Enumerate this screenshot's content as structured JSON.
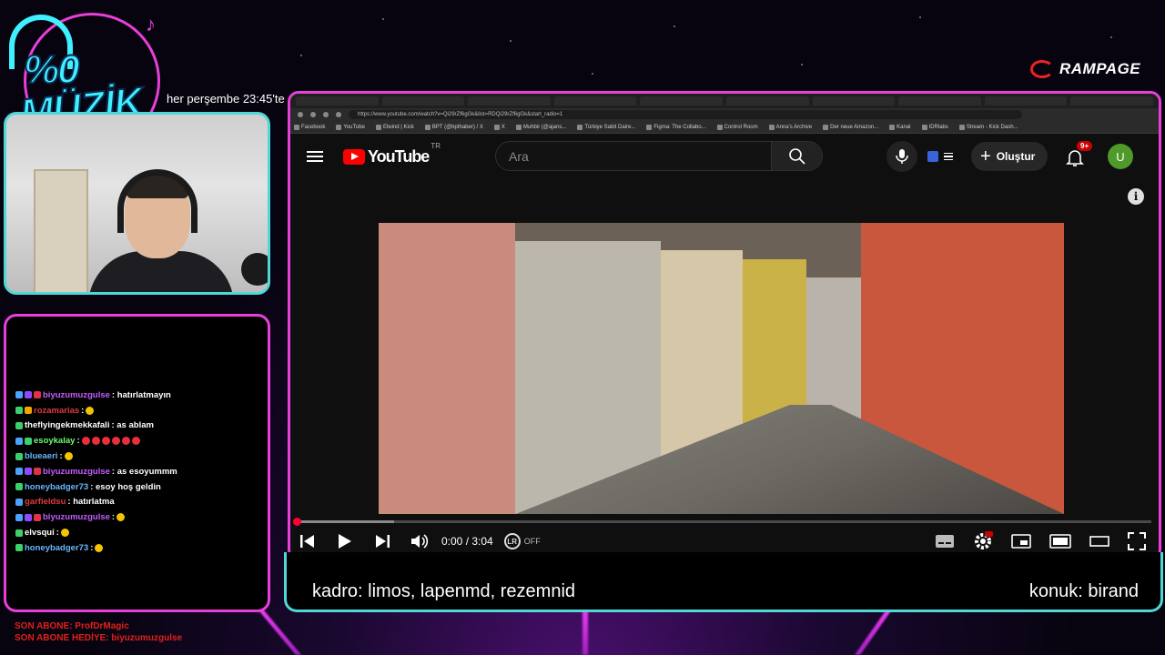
{
  "overlay": {
    "logo_pct": "%0",
    "logo_word": "MÜZİK",
    "schedule": "her perşembe 23:45'te",
    "sponsor": "RAMPAGE",
    "last_sub": "SON ABONE: ProfDrMagic",
    "last_gift": "SON ABONE HEDİYE: biyuzumuzgulse",
    "lineup": "kadro: limos, lapenmd, rezemnid",
    "guest": "konuk: birand"
  },
  "chat": [
    {
      "user": "biyuzumuzgulse",
      "color": "#c65bff",
      "text": ": hatırlatmayın",
      "badges": [
        "#4aa3ff",
        "#8c4bff",
        "#e0304a"
      ],
      "emotes": 0
    },
    {
      "user": "rozamarias",
      "color": "#e23a3a",
      "text": ":",
      "badges": [
        "#3ad16b",
        "#f0a500"
      ],
      "emotes": 1
    },
    {
      "user": "theflyingekmekkafali",
      "color": "#ffffff",
      "text": ": as ablam",
      "badges": [
        "#3ad16b"
      ],
      "emotes": 0
    },
    {
      "user": "esoykalay",
      "color": "#6cff6c",
      "text": ":",
      "badges": [
        "#4aa3ff",
        "#3ad16b"
      ],
      "emotes": 6
    },
    {
      "user": "blueaeri",
      "color": "#6ab8ff",
      "text": ":",
      "badges": [
        "#3ad16b"
      ],
      "emotes": 1
    },
    {
      "user": "biyuzumuzgulse",
      "color": "#c65bff",
      "text": ": as esoyummm",
      "badges": [
        "#4aa3ff",
        "#8c4bff",
        "#e0304a"
      ],
      "emotes": 0
    },
    {
      "user": "honeybadger73",
      "color": "#6ab8ff",
      "text": ": esoy hoş geldin",
      "badges": [
        "#3ad16b"
      ],
      "emotes": 0
    },
    {
      "user": "garfieldsu",
      "color": "#e23a3a",
      "text": ": hatırlatma",
      "badges": [
        "#4aa3ff"
      ],
      "emotes": 0
    },
    {
      "user": "biyuzumuzgulse",
      "color": "#c65bff",
      "text": ":",
      "badges": [
        "#4aa3ff",
        "#8c4bff",
        "#e0304a"
      ],
      "emotes": 1
    },
    {
      "user": "elvsqui",
      "color": "#ffffff",
      "text": ":",
      "badges": [
        "#3ad16b"
      ],
      "emotes": 1
    },
    {
      "user": "honeybadger73",
      "color": "#6ab8ff",
      "text": ":",
      "badges": [
        "#3ad16b"
      ],
      "emotes": 1
    }
  ],
  "browser": {
    "url": "https://www.youtube.com/watch?v=Qi29rZf6gGk&list=RDQi29rZf6gGk&start_radio=1",
    "bookmarks": [
      "Facebook",
      "YouTube",
      "Elwind | Kick",
      "BPT (@bpthaber) / X",
      "X",
      "Muhbir (@ajans...",
      "Türkiye Sabit Daire...",
      "Figma: The Collabo...",
      "Control Room",
      "Anna's Archive",
      "Der neue Amazon...",
      "Kanal",
      "IDRlabs",
      "Stream - Kick Dash..."
    ]
  },
  "youtube": {
    "brand": "YouTube",
    "region": "TR",
    "search_placeholder": "Ara",
    "create_label": "Oluştur",
    "notifications": "9+",
    "avatar_letter": "U",
    "info": "i"
  },
  "player": {
    "time": "0:00 / 3:04",
    "lr_label": "LR",
    "lr_state": "OFF",
    "progress": 0,
    "buffered": 0.115
  }
}
